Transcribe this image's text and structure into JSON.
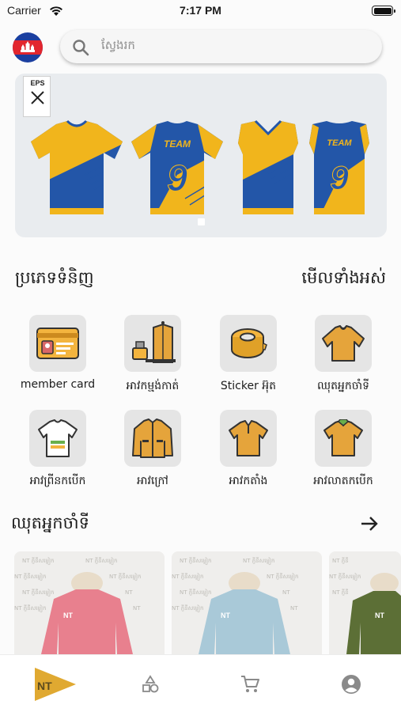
{
  "status_bar": {
    "carrier": "Carrier",
    "time": "7:17 PM"
  },
  "header": {
    "flag": "cambodia-flag-icon",
    "search_placeholder": "ស្វែងរក"
  },
  "banner": {
    "badge": "EPS",
    "jerseys": [
      "jersey-front",
      "jersey-team-9",
      "jersey-vneck",
      "jersey-team-9"
    ],
    "jersey_numbers": [
      "9",
      "9"
    ],
    "jersey_team_text": "TEAM"
  },
  "categories_section": {
    "title": "ប្រភេទទំនិញ",
    "view_all": "មើលទាំងអស់",
    "items": [
      {
        "label": "member card",
        "icon": "id-card-icon"
      },
      {
        "label": "អាវកម្មង់កាត់",
        "icon": "tailor-icon"
      },
      {
        "label": "Sticker អ៊ុត",
        "icon": "tape-roll-icon"
      },
      {
        "label": "ឈុតអ្នកចាំទី",
        "icon": "goalkeeper-shirt-icon"
      },
      {
        "label": "អាវព្រីនកបើក",
        "icon": "printed-shirt-icon"
      },
      {
        "label": "អាវក្រៅ",
        "icon": "jacket-icon"
      },
      {
        "label": "អាវកតាំង",
        "icon": "polo-shirt-icon"
      },
      {
        "label": "អាវលាតកបើក",
        "icon": "open-collar-shirt-icon"
      }
    ]
  },
  "products_section": {
    "title": "ឈុតអ្នកចាំទី",
    "products": [
      {
        "color": "#e8808e"
      },
      {
        "color": "#a9c9d8"
      },
      {
        "color": "#5c6f36"
      }
    ]
  },
  "tab_bar": {
    "tabs": [
      "home-logo-icon",
      "categories-shapes-icon",
      "cart-icon",
      "account-icon"
    ],
    "logo_text": "NT"
  },
  "colors": {
    "accent": "#e0a931",
    "primary_blue": "#2356a8",
    "gold": "#f1b51c"
  }
}
